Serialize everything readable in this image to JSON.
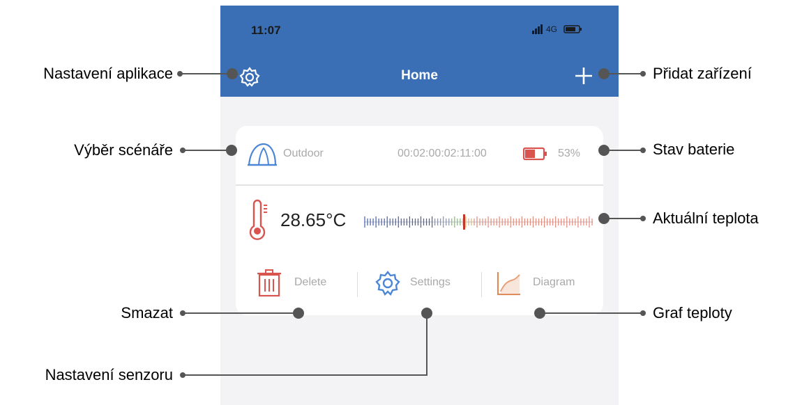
{
  "status_bar": {
    "time": "11:07",
    "signal_label": "4G"
  },
  "header": {
    "title": "Home"
  },
  "card": {
    "scenario": "Outdoor",
    "timer": "00:02:00:02:11:00",
    "battery_percent": "53%",
    "temperature": "28.65°C",
    "actions": {
      "delete": "Delete",
      "settings": "Settings",
      "diagram": "Diagram"
    }
  },
  "callouts": {
    "app_settings": "Nastavení aplikace",
    "add_device": "Přidat zařízení",
    "scenario_select": "Výběr scénáře",
    "battery_state": "Stav baterie",
    "current_temp": "Aktuální teplota",
    "delete": "Smazat",
    "temp_graph": "Graf teploty",
    "sensor_settings": "Nastavení senzoru"
  },
  "colors": {
    "header_blue": "#3a6fb6",
    "accent_red": "#d9534f",
    "icon_blue": "#4b86d6",
    "diagram_orange": "#e08a5a"
  }
}
